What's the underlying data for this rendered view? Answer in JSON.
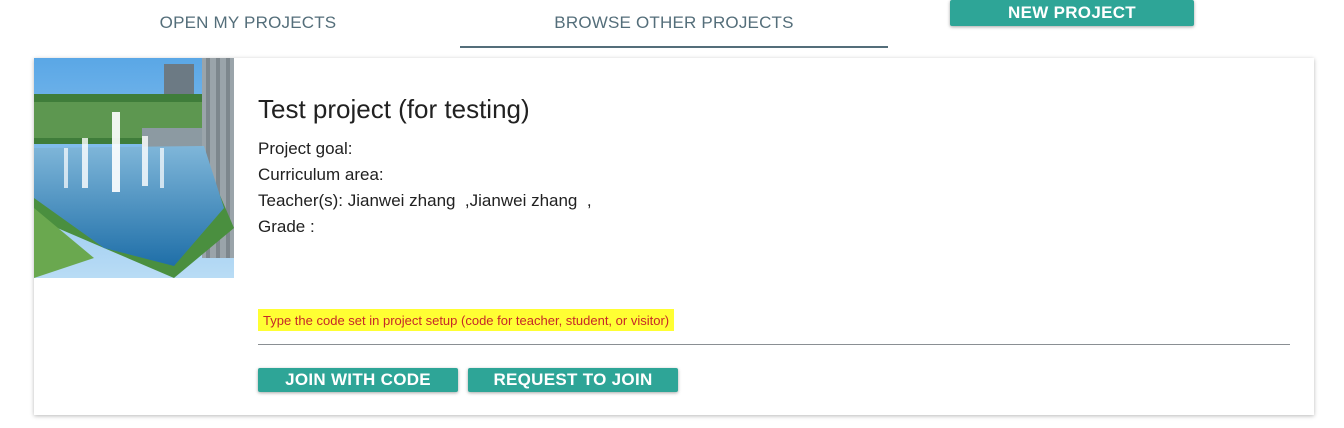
{
  "tabs": {
    "open_my_projects": "OPEN MY PROJECTS",
    "browse_other_projects": "BROWSE OTHER PROJECTS",
    "active": "browse_other_projects"
  },
  "new_project_label": "NEW PROJECT",
  "project": {
    "title": "Test project (for testing)",
    "goal_line": "Project goal:",
    "area_line": "Curriculum area:",
    "teacher_line": "Teacher(s): Jianwei zhang  ,Jianwei zhang  ,",
    "grade_line": "Grade :",
    "image": "campus-fountain-photo",
    "code_hint": "Type the code set in project setup (code for teacher, student, or visitor)",
    "code_value": "",
    "join_label": "JOIN WITH CODE",
    "request_label": "REQUEST TO JOIN"
  },
  "colors": {
    "accent": "#2ea597",
    "tab_text": "#546e7a",
    "hint_background": "#ffff33",
    "hint_text": "#c62828"
  }
}
